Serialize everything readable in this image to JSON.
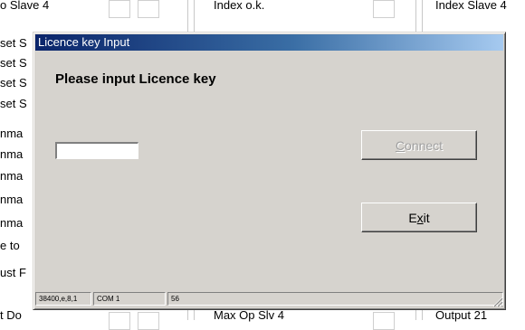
{
  "background": {
    "top_row": {
      "left": "o Slave 4",
      "middle": "Index o.k.",
      "right": "Index Slave 4"
    },
    "left_column": [
      "set S",
      "set S",
      "set S",
      "set S",
      "nma",
      "nma",
      "nma",
      "nma",
      "nma",
      "e to",
      "ust F"
    ],
    "bottom_row": {
      "left": "t Do",
      "middle": "Max Op Slv 4",
      "right": "Output 21"
    }
  },
  "dialog": {
    "title": "Licence key Input",
    "prompt": "Please input Licence key",
    "licence_input": {
      "value": "",
      "placeholder": ""
    },
    "connect_button": {
      "mnemonic": "C",
      "rest": "onnect",
      "enabled": false
    },
    "exit_button": {
      "pre": "E",
      "mnemonic": "x",
      "post": "it",
      "enabled": true
    },
    "statusbar": {
      "serial_settings": "38400,e,8,1",
      "port": "COM 1",
      "value": "56"
    }
  },
  "colors": {
    "dialog_face": "#d6d3ce",
    "title_start": "#0a246a",
    "title_end": "#a6caf0",
    "disabled_text": "#a0a0a0"
  }
}
